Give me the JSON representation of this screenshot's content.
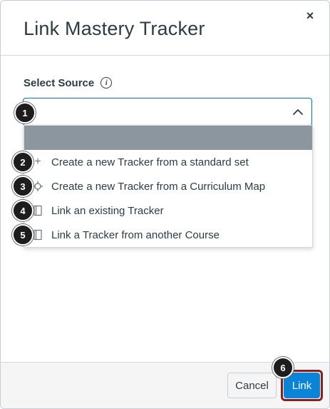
{
  "modal": {
    "title": "Link Mastery Tracker",
    "close_glyph": "×"
  },
  "form": {
    "label": "Select Source",
    "info_icon": "info-icon",
    "select_value": "",
    "chevron_icon": "chevron-up-icon"
  },
  "dropdown": {
    "items": [
      {
        "icon": "plus-icon",
        "glyph": "+",
        "label": "Create a new Tracker from a standard set"
      },
      {
        "icon": "target-icon",
        "glyph": "⌖",
        "label": "Create a new Tracker from a Curriculum Map"
      },
      {
        "icon": "tracker-icon",
        "glyph": "▯",
        "label": "Link an existing Tracker"
      },
      {
        "icon": "tracker-icon",
        "glyph": "▯",
        "label": "Link a Tracker from another Course"
      }
    ]
  },
  "callouts": [
    "1",
    "2",
    "3",
    "4",
    "5",
    "6"
  ],
  "footer": {
    "cancel_label": "Cancel",
    "link_label": "Link"
  },
  "colors": {
    "accent": "#0b84d8",
    "highlight_outline": "#8b1f1f",
    "dropdown_highlight": "#8b969e"
  }
}
